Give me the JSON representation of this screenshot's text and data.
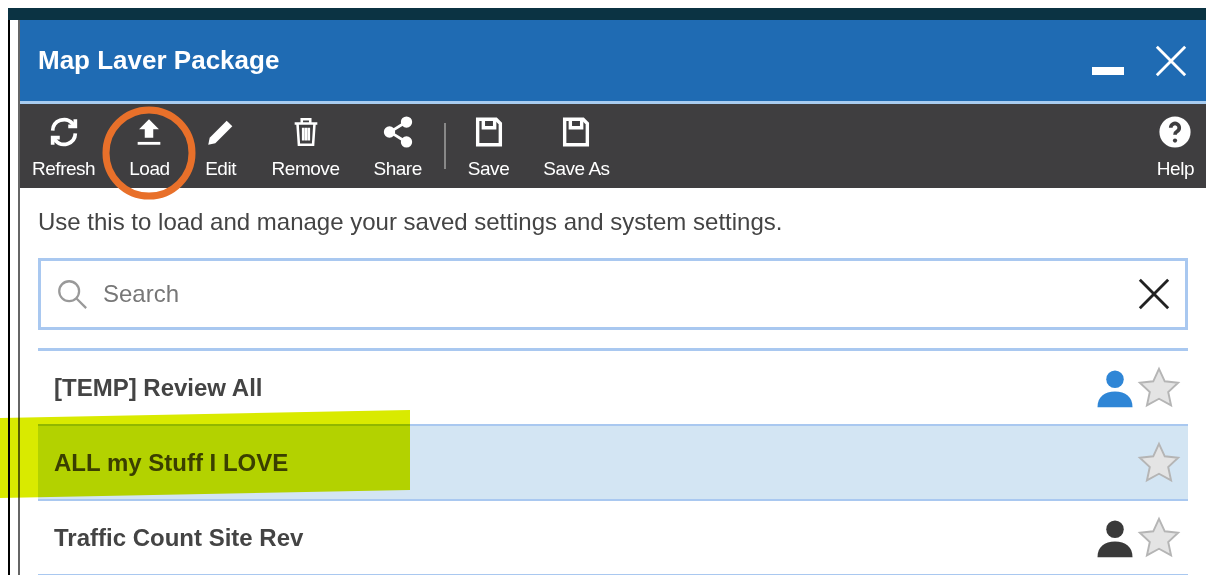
{
  "window": {
    "title": "Map Laver Package"
  },
  "toolbar": [
    {
      "label": "Refresh",
      "kind": "refresh"
    },
    {
      "label": "Load",
      "kind": "load"
    },
    {
      "label": "Edit",
      "kind": "edit"
    },
    {
      "label": "Remove",
      "kind": "remove"
    },
    {
      "label": "Share",
      "kind": "share"
    },
    {
      "label": "Save",
      "kind": "save"
    },
    {
      "label": "Save As",
      "kind": "save"
    },
    {
      "label": "Help",
      "kind": "help"
    }
  ],
  "description": "Use this to load and manage your saved settings and system settings.",
  "search": {
    "placeholder": "Search"
  },
  "items": [
    {
      "name": "[TEMP] Review All",
      "selected": false,
      "color": "#2f86d6",
      "starred": false,
      "highlighted": false
    },
    {
      "name": "ALL my Stuff I LOVE",
      "selected": true,
      "starred": false,
      "highlighted": true
    },
    {
      "name": "Traffic Count Site Rev",
      "selected": false,
      "color": "#3a3a3a",
      "starred": false,
      "highlighted": false
    }
  ],
  "annotations": {
    "circle_on_toolbar": true
  }
}
